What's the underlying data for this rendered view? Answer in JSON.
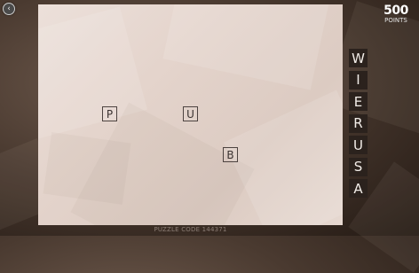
{
  "icons": {
    "back": "back-arrow-icon"
  },
  "score": {
    "value": "500",
    "label": "POINTS"
  },
  "board": {
    "placed_tiles": [
      {
        "letter": "P"
      },
      {
        "letter": "U"
      },
      {
        "letter": "B"
      }
    ]
  },
  "rack": {
    "letters": [
      "W",
      "I",
      "E",
      "R",
      "U",
      "S",
      "A"
    ]
  },
  "footer": {
    "puzzle_code": "PUZZLE CODE 144371"
  },
  "colors": {
    "board": "#e6d8d0",
    "tile_border": "#4d4340",
    "rack_tile": "#2b221d",
    "rack_letter": "#f2ede8",
    "score_text": "#ffffff"
  }
}
